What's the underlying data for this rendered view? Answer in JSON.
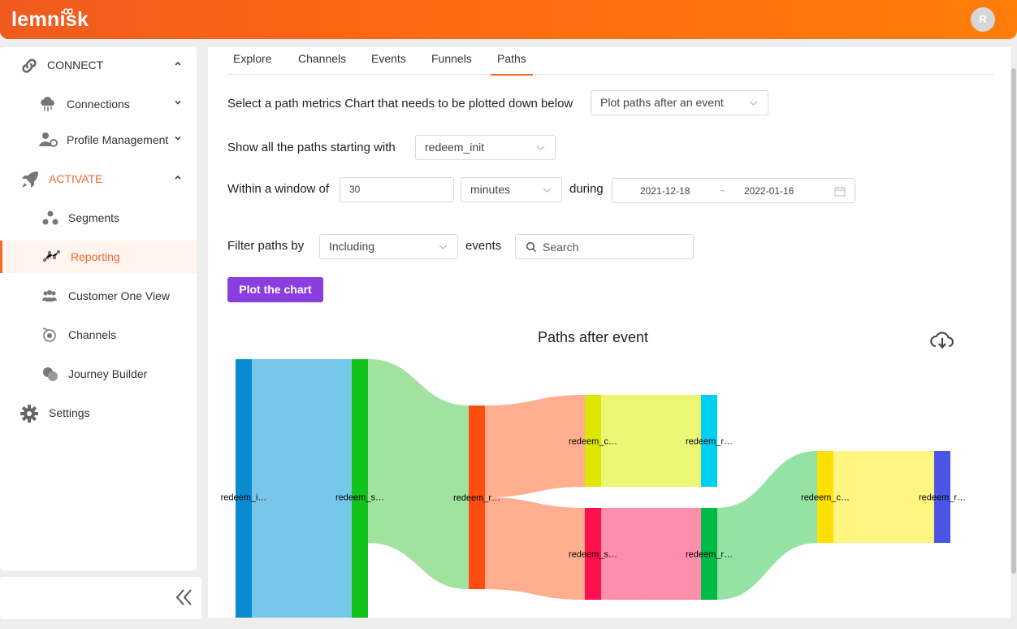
{
  "app": {
    "logo_text": "lemnisk",
    "user_initial": "R"
  },
  "sidebar": {
    "connect": {
      "label": "CONNECT"
    },
    "connections": {
      "label": "Connections"
    },
    "profile_management": {
      "label": "Profile Management"
    },
    "activate": {
      "label": "ACTIVATE"
    },
    "segments": {
      "label": "Segments"
    },
    "reporting": {
      "label": "Reporting"
    },
    "customer_one_view": {
      "label": "Customer One View"
    },
    "channels": {
      "label": "Channels"
    },
    "journey_builder": {
      "label": "Journey Builder"
    },
    "settings": {
      "label": "Settings"
    }
  },
  "tabs": [
    "Explore",
    "Channels",
    "Events",
    "Funnels",
    "Paths"
  ],
  "active_tab": "Paths",
  "form": {
    "chart_select_label": "Select a path metrics Chart that needs to be plotted down below",
    "chart_select_value": "Plot paths after an event",
    "start_label": "Show all the paths starting with",
    "start_value": "redeem_init",
    "window_label": "Within a window of",
    "window_value": "30",
    "window_unit": "minutes",
    "during_label": "during",
    "date_start": "2021-12-18",
    "date_sep": "~",
    "date_end": "2022-01-16",
    "filter_label": "Filter paths by",
    "filter_value": "Including",
    "events_label": "events",
    "search_placeholder": "Search",
    "plot_button": "Plot the chart"
  },
  "chart_data": {
    "type": "sankey",
    "title": "Paths after event",
    "nodes": [
      {
        "id": "n0",
        "label": "redeem_i…",
        "color": "#0a8ad0"
      },
      {
        "id": "n1",
        "label": "redeem_s…",
        "color": "#12c11a"
      },
      {
        "id": "n2",
        "label": "redeem_r…",
        "color": "#ff4d12"
      },
      {
        "id": "n3",
        "label": "redeem_c…",
        "color": "#dde600"
      },
      {
        "id": "n4",
        "label": "redeem_s…",
        "color": "#ff0f4b"
      },
      {
        "id": "n5",
        "label": "redeem_r…",
        "color": "#00cfee"
      },
      {
        "id": "n6",
        "label": "redeem_r…",
        "color": "#00bb44"
      },
      {
        "id": "n7",
        "label": "redeem_c…",
        "color": "#ffe000"
      },
      {
        "id": "n8",
        "label": "redeem_r…",
        "color": "#4a55e3"
      }
    ],
    "links": [
      {
        "source": "n0",
        "target": "n1",
        "value": 1,
        "color": "#6fc4e8"
      },
      {
        "source": "n0",
        "target": "n1",
        "value": 1,
        "color": "#6fc4e8"
      },
      {
        "source": "n0",
        "target": "n1",
        "value": 1,
        "color": "#6fc4e8"
      },
      {
        "source": "n1",
        "target": "n2",
        "value": 2,
        "color": "#9be099"
      },
      {
        "source": "n2",
        "target": "n3",
        "value": 1,
        "color": "#ffab8a"
      },
      {
        "source": "n2",
        "target": "n4",
        "value": 1,
        "color": "#ffab8a"
      },
      {
        "source": "n3",
        "target": "n5",
        "value": 1,
        "color": "#ebf56e"
      },
      {
        "source": "n4",
        "target": "n6",
        "value": 1,
        "color": "#ff88a8"
      },
      {
        "source": "n6",
        "target": "n7",
        "value": 1,
        "color": "#8ee2a0"
      },
      {
        "source": "n7",
        "target": "n8",
        "value": 1,
        "color": "#fff47a"
      }
    ]
  }
}
